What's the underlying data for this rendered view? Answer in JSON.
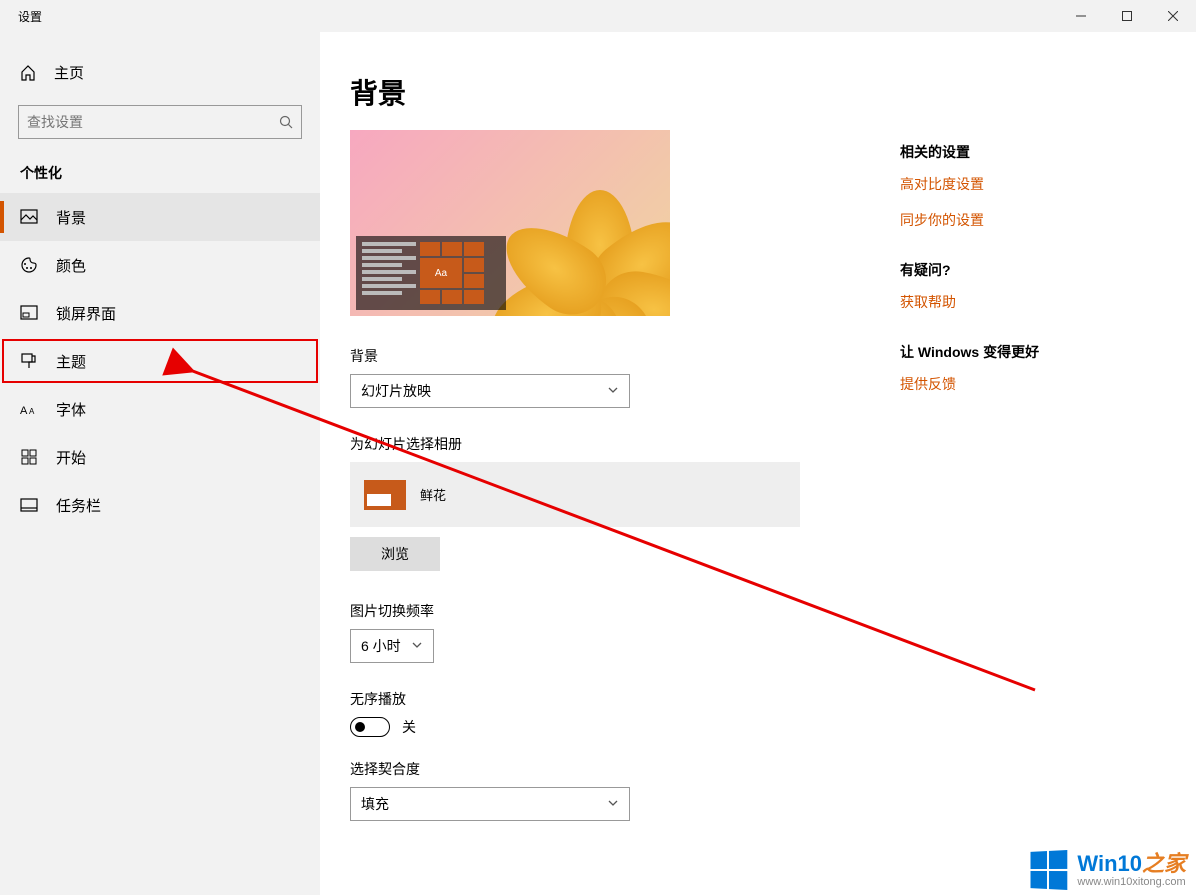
{
  "window": {
    "title": "设置"
  },
  "sidebar": {
    "home": "主页",
    "search_placeholder": "查找设置",
    "category": "个性化",
    "items": [
      {
        "label": "背景"
      },
      {
        "label": "颜色"
      },
      {
        "label": "锁屏界面"
      },
      {
        "label": "主题"
      },
      {
        "label": "字体"
      },
      {
        "label": "开始"
      },
      {
        "label": "任务栏"
      }
    ]
  },
  "main": {
    "title": "背景",
    "preview_tile_text": "Aa",
    "bg_label": "背景",
    "bg_value": "幻灯片放映",
    "album_label": "为幻灯片选择相册",
    "album_value": "鲜花",
    "browse_btn": "浏览",
    "interval_label": "图片切换频率",
    "interval_value": "6 小时",
    "shuffle_label": "无序播放",
    "shuffle_state": "关",
    "fit_label": "选择契合度",
    "fit_value": "填充"
  },
  "right": {
    "related_head": "相关的设置",
    "link_contrast": "高对比度设置",
    "link_sync": "同步你的设置",
    "question_head": "有疑问?",
    "link_help": "获取帮助",
    "improve_head": "让 Windows 变得更好",
    "link_feedback": "提供反馈"
  },
  "watermark": {
    "brand": "Win10",
    "suffix": "之家",
    "url": "www.win10xitong.com"
  }
}
